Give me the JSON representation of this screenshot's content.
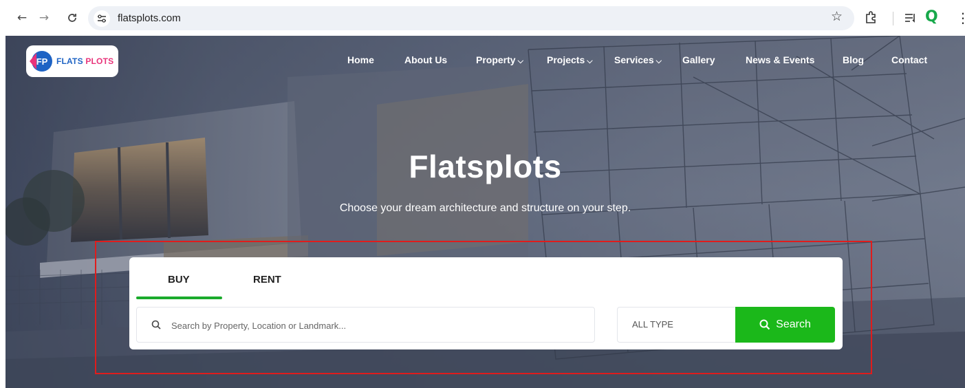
{
  "browser": {
    "url": "flatsplots.com"
  },
  "logo": {
    "part1": "FLATS",
    "part2": "PLOTS",
    "mark": "FP"
  },
  "menu": {
    "items": [
      {
        "label": "Home",
        "has_dropdown": false
      },
      {
        "label": "About Us",
        "has_dropdown": false
      },
      {
        "label": "Property",
        "has_dropdown": true
      },
      {
        "label": "Projects",
        "has_dropdown": true
      },
      {
        "label": "Services",
        "has_dropdown": true
      },
      {
        "label": "Gallery",
        "has_dropdown": false
      },
      {
        "label": "News & Events",
        "has_dropdown": false
      },
      {
        "label": "Blog",
        "has_dropdown": false
      },
      {
        "label": "Contact",
        "has_dropdown": false
      }
    ]
  },
  "hero": {
    "title": "Flatsplots",
    "subtitle": "Choose your dream architecture and structure on your step."
  },
  "search": {
    "tabs": [
      {
        "label": "BUY",
        "active": true
      },
      {
        "label": "RENT",
        "active": false
      }
    ],
    "placeholder": "Search by Property, Location or Landmark...",
    "type_value": "ALL TYPE",
    "button_label": "Search"
  },
  "colors": {
    "accent": "#1bb81a",
    "logo_blue": "#1e63c4",
    "logo_pink": "#e8337a",
    "highlight": "#e01c1c"
  }
}
